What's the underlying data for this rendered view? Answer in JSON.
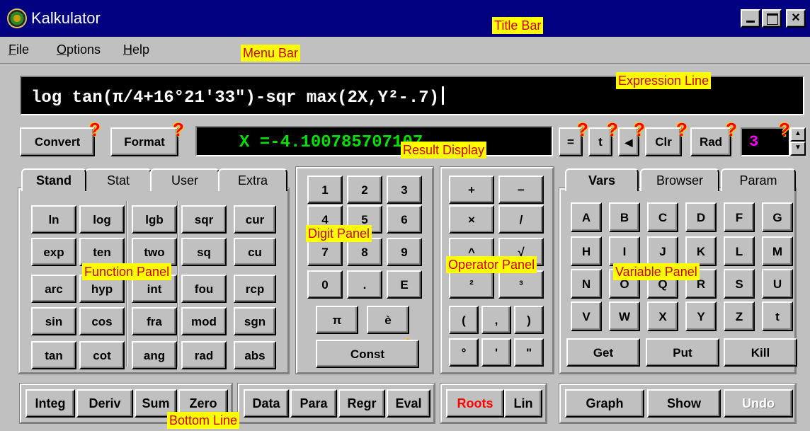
{
  "window": {
    "title": "Kalkulator"
  },
  "menu": [
    {
      "label": "File",
      "accel": "F",
      "rest": "ile"
    },
    {
      "label": "Options",
      "accel": "O",
      "rest": "ptions"
    },
    {
      "label": "Help",
      "accel": "H",
      "rest": "elp"
    }
  ],
  "expression": "log tan(π/4+16°21'33\")-sqr max(2X,Y²-.7)",
  "result": "X =-4.10078570",
  "result_trailing": "7107",
  "precision": "3",
  "toolbar": {
    "convert": "Convert",
    "format": "Format",
    "equals": "=",
    "t": "t",
    "back": "◀",
    "clr": "Clr",
    "rad": "Rad"
  },
  "function_tabs": [
    "Stand",
    "Stat",
    "User",
    "Extra"
  ],
  "function_buttons": [
    [
      "ln",
      "log",
      "lgb",
      "sqr",
      "cur"
    ],
    [
      "exp",
      "ten",
      "two",
      "sq",
      "cu"
    ],
    [
      "arc",
      "hyp",
      "int",
      "fou",
      "rcp"
    ],
    [
      "sin",
      "cos",
      "fra",
      "mod",
      "sgn"
    ],
    [
      "tan",
      "cot",
      "ang",
      "rad",
      "abs"
    ]
  ],
  "digit_buttons": [
    [
      "1",
      "2",
      "3"
    ],
    [
      "4",
      "5",
      "6"
    ],
    [
      "7",
      "8",
      "9"
    ],
    [
      "0",
      ".",
      "E"
    ]
  ],
  "digit_extra": [
    "π",
    "è"
  ],
  "const_label": "Const",
  "operator_buttons": [
    [
      "+",
      "−"
    ],
    [
      "×",
      "/"
    ],
    [
      "^",
      "√"
    ],
    [
      "²",
      "³"
    ],
    [
      "(",
      ",",
      ")"
    ],
    [
      "°",
      "'",
      "\""
    ]
  ],
  "variable_tabs": [
    "Vars",
    "Browser",
    "Param"
  ],
  "variable_buttons": [
    [
      "A",
      "B",
      "C",
      "D",
      "F",
      "G"
    ],
    [
      "H",
      "I",
      "J",
      "K",
      "L",
      "M"
    ],
    [
      "N",
      "O",
      "Q",
      "R",
      "S",
      "U"
    ],
    [
      "V",
      "W",
      "X",
      "Y",
      "Z",
      "t"
    ]
  ],
  "var_actions": [
    "Get",
    "Put",
    "Kill"
  ],
  "bottom": {
    "group1": [
      "Integ",
      "Deriv",
      "Sum",
      "Zero"
    ],
    "group2": [
      "Data",
      "Para",
      "Regr",
      "Eval"
    ],
    "roots": "Roots",
    "lin": "Lin",
    "graph": "Graph",
    "show": "Show",
    "undo": "Undo"
  },
  "annotations": {
    "title_bar": "Title Bar",
    "menu_bar": "Menu Bar",
    "expression_line": "Expression Line",
    "result_display": "Result Display",
    "digit_panel": "Digit Panel",
    "function_panel": "Function Panel",
    "operator_panel": "Operator Panel",
    "variable_panel": "Variable Panel",
    "bottom_line": "Bottom Line"
  },
  "colors": {
    "title_bg": "#000080",
    "face": "#c0c0c0",
    "result_fg": "#00e000",
    "precision_fg": "#ff00ff",
    "roots_fg": "#ff0000",
    "help_mark": "#ff0000",
    "annotation_bg": "#ffff00",
    "annotation_fg": "#cc0000"
  },
  "help_mark": "?"
}
